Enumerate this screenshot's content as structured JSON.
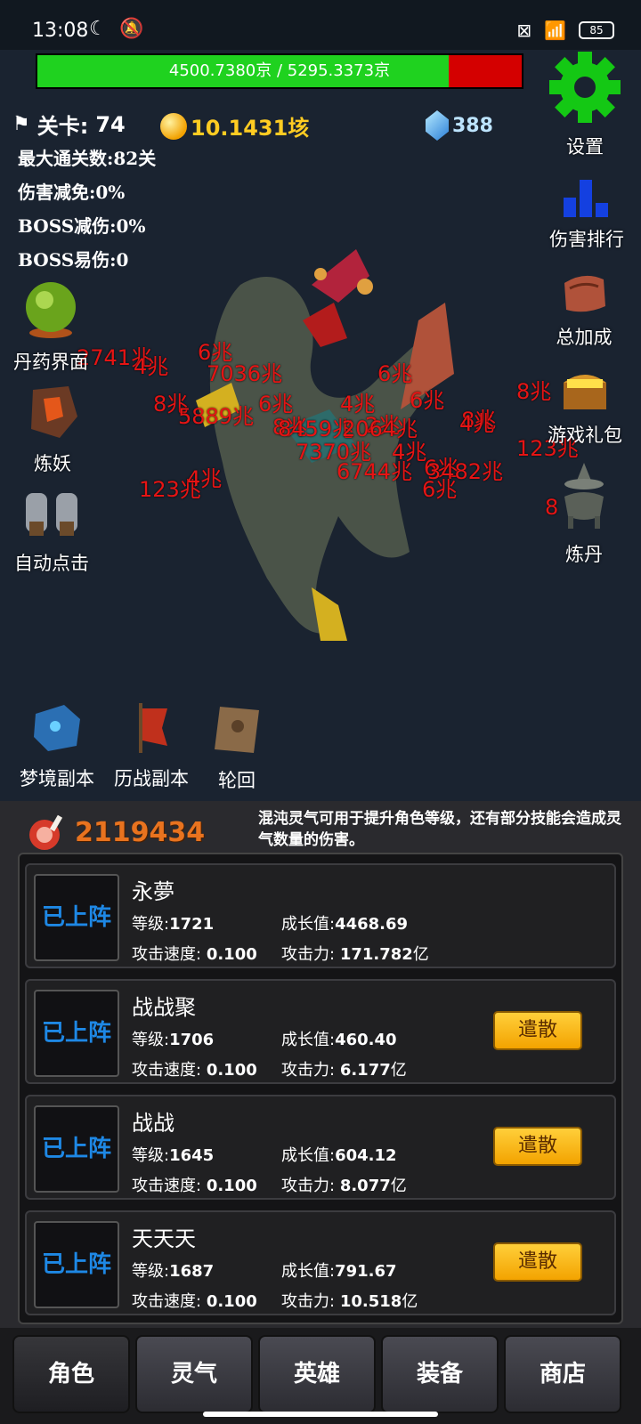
{
  "status": {
    "time": "13:08",
    "battery": "85"
  },
  "hp": {
    "text": "4500.7380京 / 5295.3373京",
    "fraction": 0.85
  },
  "stats": {
    "stage_label": "关卡:",
    "stage_value": "74",
    "coins": "10.1431垓",
    "gems": "388",
    "max_stage": "最大通关数:82关",
    "damage_reduction": "伤害减免:0%",
    "boss_reduction": "BOSS减伤:0%",
    "boss_vuln": "BOSS易伤:0"
  },
  "left_buttons": [
    "丹药界面",
    "炼妖",
    "自动点击"
  ],
  "right_buttons": [
    "设置",
    "伤害排行",
    "总加成",
    "游戏礼包",
    "炼丹"
  ],
  "dungeons": [
    "梦境副本",
    "历战副本",
    "轮回"
  ],
  "damage_numbers": [
    "2741兆",
    "4兆",
    "6兆",
    "7036兆",
    "6兆",
    "8兆",
    "5889兆",
    "6兆",
    "8兆",
    "4兆",
    "6兆",
    "8兆",
    "2兆",
    "8兆",
    "8459兆",
    "2064兆",
    "7370兆",
    "4兆",
    "6兆",
    "4兆",
    "3482兆",
    "6744兆",
    "6兆",
    "123兆",
    "4兆",
    "123兆",
    "8"
  ],
  "panel": {
    "qi_value": "2119434",
    "qi_desc": "混沌灵气可用于提升角色等级，还有部分技能会造成灵气数量的伤害。"
  },
  "labels": {
    "level": "等级:",
    "growth": "成长值:",
    "speed": "攻击速度:",
    "attack": "攻击力:",
    "deployed": "已上阵",
    "dismiss": "遣散"
  },
  "heroes": [
    {
      "name": "永夢",
      "level": "1721",
      "growth": "4468.69",
      "speed": "0.100",
      "attack": "171.782",
      "attack_unit": "亿"
    },
    {
      "name": "战战聚",
      "level": "1706",
      "growth": "460.40",
      "speed": "0.100",
      "attack": "6.177",
      "attack_unit": "亿"
    },
    {
      "name": "战战",
      "level": "1645",
      "growth": "604.12",
      "speed": "0.100",
      "attack": "8.077",
      "attack_unit": "亿"
    },
    {
      "name": "天天天",
      "level": "1687",
      "growth": "791.67",
      "speed": "0.100",
      "attack": "10.518",
      "attack_unit": "亿"
    }
  ],
  "tabs": [
    "角色",
    "灵气",
    "英雄",
    "装备",
    "商店"
  ]
}
